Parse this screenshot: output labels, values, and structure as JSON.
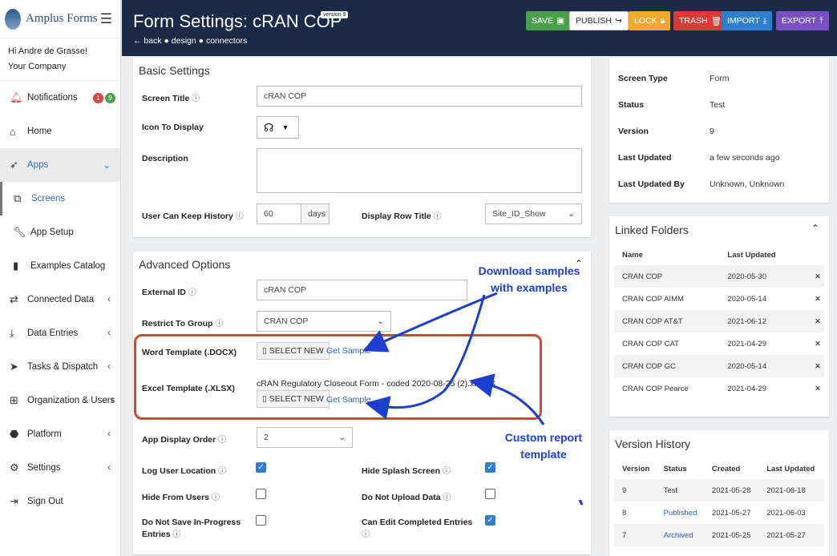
{
  "app": {
    "name": "Amplus Forms"
  },
  "user": {
    "greeting": "Hi Andre de Grasse!",
    "company": "Your Company"
  },
  "nav": [
    {
      "label": "Notifications",
      "icon": "bell-icon",
      "badges": [
        "1",
        "9"
      ]
    },
    {
      "label": "Home",
      "icon": "home-icon"
    },
    {
      "label": "Apps",
      "icon": "rocket-icon"
    },
    {
      "label": "Screens",
      "icon": "screens-icon"
    },
    {
      "label": "App Setup",
      "icon": "wrench-icon"
    },
    {
      "label": "Examples Catalog",
      "icon": "book-icon"
    },
    {
      "label": "Connected Data",
      "icon": "data-icon"
    },
    {
      "label": "Data Entries",
      "icon": "download-icon"
    },
    {
      "label": "Tasks & Dispatch",
      "icon": "send-icon"
    },
    {
      "label": "Organization & Users",
      "icon": "org-icon"
    },
    {
      "label": "Platform",
      "icon": "platform-icon"
    },
    {
      "label": "Settings",
      "icon": "gears-icon"
    },
    {
      "label": "Sign Out",
      "icon": "signout-icon"
    }
  ],
  "header": {
    "title": "Form Settings: cRAN COP",
    "version_badge": "version 9",
    "crumbs": [
      "back",
      "design",
      "connectors"
    ],
    "buttons": [
      {
        "label": "SAVE",
        "color": "#4aa04a"
      },
      {
        "label": "PUBLISH",
        "color": "#ffffff"
      },
      {
        "label": "LOCK",
        "color": "#f0a830"
      },
      {
        "label": "TRASH",
        "color": "#d93a35"
      },
      {
        "label": "IMPORT",
        "color": "#2f7fd1"
      },
      {
        "label": "EXPORT",
        "color": "#7a4fc4"
      }
    ]
  },
  "basic": {
    "heading": "Basic Settings",
    "screen_title_label": "Screen Title",
    "screen_title_value": "cRAN COP",
    "icon_label": "Icon To Display",
    "description_label": "Description",
    "history_label": "User Can Keep History",
    "history_value": "60",
    "history_unit": "days",
    "row_title_label": "Display Row Title",
    "row_title_value": "Site_ID_Show"
  },
  "advanced": {
    "heading": "Advanced Options",
    "external_id_label": "External ID",
    "external_id_value": "cRAN COP",
    "restrict_label": "Restrict To Group",
    "restrict_value": "CRAN COP",
    "word_label": "Word Template (.DOCX)",
    "excel_label": "Excel Template (.XLSX)",
    "select_new": "SELECT NEW",
    "get_sample": "Get Sample",
    "excel_file": "cRAN Regulatory Closeout Form - coded 2020-08-25 (2).xlsx",
    "order_label": "App Display Order",
    "order_value": "2",
    "log_location_label": "Log User Location",
    "hide_splash_label": "Hide Splash Screen",
    "hide_users_label": "Hide From Users",
    "no_upload_label": "Do Not Upload Data",
    "no_save_label_1": "Do Not Save In-Progress",
    "no_save_label_2": "Entries",
    "edit_completed_label": "Can Edit Completed Entries",
    "log_location": true,
    "hide_splash": true,
    "hide_users": false,
    "no_upload": false,
    "no_save": false,
    "edit_completed": true
  },
  "info": {
    "rows": [
      {
        "k": "Screen Type",
        "v": "Form"
      },
      {
        "k": "Status",
        "v": "Test"
      },
      {
        "k": "Version",
        "v": "9"
      },
      {
        "k": "Last Updated",
        "v": "a few seconds ago"
      },
      {
        "k": "Last Updated By",
        "v": "Unknown, Unknown"
      }
    ]
  },
  "folders": {
    "heading": "Linked Folders",
    "headers": [
      "Name",
      "Last Updated"
    ],
    "rows": [
      [
        "CRAN COP",
        "2020-05-30"
      ],
      [
        "CRAN COP AIMM",
        "2020-05-14"
      ],
      [
        "CRAN COP AT&T",
        "2021-06-12"
      ],
      [
        "CRAN COP CAT",
        "2021-04-29"
      ],
      [
        "CRAN COP GC",
        "2020-05-14"
      ],
      [
        "CRAN COP Pearce",
        "2021-04-29"
      ]
    ]
  },
  "versions": {
    "heading": "Version History",
    "headers": [
      "Version",
      "Status",
      "Created",
      "Last Updated"
    ],
    "rows": [
      [
        "9",
        "Test",
        "2021-05-28",
        "2021-06-18"
      ],
      [
        "8",
        "Published",
        "2021-05-27",
        "2021-06-03"
      ],
      [
        "7",
        "Archived",
        "2021-05-25",
        "2021-05-27"
      ]
    ]
  },
  "annotations": {
    "download_1": "Download samples",
    "download_2": "with examples",
    "custom_1": "Custom report",
    "custom_2": "template"
  }
}
